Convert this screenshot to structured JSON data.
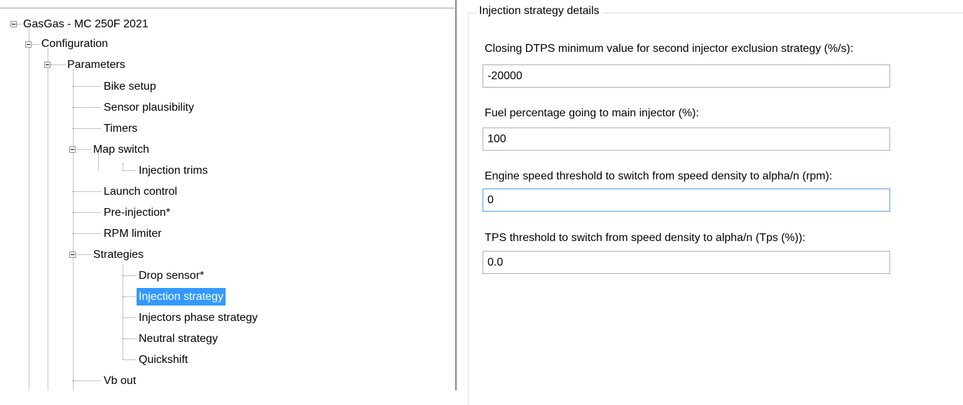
{
  "tree": {
    "root": "GasGas - MC 250F 2021",
    "configuration": "Configuration",
    "parameters": "Parameters",
    "bike_setup": "Bike setup",
    "sensor_plausibility": "Sensor plausibility",
    "timers": "Timers",
    "map_switch": "Map switch",
    "injection_trims": "Injection trims",
    "launch_control": "Launch control",
    "pre_injection": "Pre-injection*",
    "rpm_limiter": "RPM limiter",
    "strategies": "Strategies",
    "drop_sensor": "Drop sensor*",
    "injection_strategy": "Injection strategy",
    "injectors_phase_strategy": "Injectors phase strategy",
    "neutral_strategy": "Neutral strategy",
    "quickshift": "Quickshift",
    "vb_out": "Vb out"
  },
  "details": {
    "group_title": "Injection strategy details",
    "fields": [
      {
        "label": "Closing DTPS minimum value for second injector exclusion strategy (%/s):",
        "value": "-20000"
      },
      {
        "label": "Fuel percentage going to main injector (%):",
        "value": "100"
      },
      {
        "label": "Engine speed threshold to switch from speed density to alpha/n (rpm):",
        "value": "0"
      },
      {
        "label": "TPS threshold to switch from speed density to alpha/n (Tps (%)):",
        "value": "0.0"
      }
    ]
  },
  "colors": {
    "selection": "#3399ff",
    "focus_border": "#569de5",
    "input_border": "#abadb3",
    "group_border": "#d5dfe5"
  }
}
